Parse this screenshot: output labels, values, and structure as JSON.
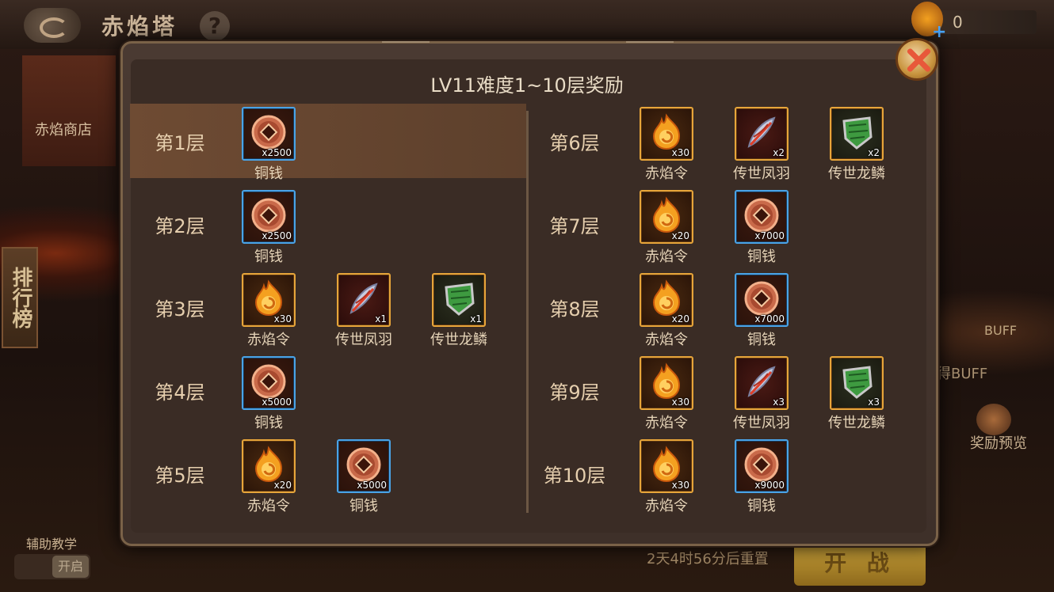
{
  "header": {
    "title": "赤焰塔",
    "help": "?",
    "currency_value": "0",
    "currency_plus": "+"
  },
  "sidebar": {
    "shop_label": "赤焰商店",
    "rank_label": "排行榜",
    "tutorial_label": "辅助教学",
    "tutorial_toggle": "开启"
  },
  "right_side": {
    "buff_label": "BUFF",
    "buff_text": "得BUFF",
    "preview_label": "奖励预览"
  },
  "footer": {
    "reset_text": "2天4时56分后重置",
    "fight_label": "开 战"
  },
  "modal": {
    "title": "LV11难度1~10层奖励",
    "left_rows": [
      {
        "floor": "第1层",
        "highlight": true,
        "items": [
          {
            "type": "coin",
            "name": "铜钱",
            "qty": "x2500"
          }
        ]
      },
      {
        "floor": "第2层",
        "items": [
          {
            "type": "coin",
            "name": "铜钱",
            "qty": "x2500"
          }
        ]
      },
      {
        "floor": "第3层",
        "items": [
          {
            "type": "flame",
            "name": "赤焰令",
            "qty": "x30"
          },
          {
            "type": "feather",
            "name": "传世凤羽",
            "qty": "x1"
          },
          {
            "type": "scale",
            "name": "传世龙鳞",
            "qty": "x1"
          }
        ]
      },
      {
        "floor": "第4层",
        "items": [
          {
            "type": "coin",
            "name": "铜钱",
            "qty": "x5000"
          }
        ]
      },
      {
        "floor": "第5层",
        "items": [
          {
            "type": "flame",
            "name": "赤焰令",
            "qty": "x20"
          },
          {
            "type": "coin",
            "name": "铜钱",
            "qty": "x5000"
          }
        ]
      }
    ],
    "right_rows": [
      {
        "floor": "第6层",
        "items": [
          {
            "type": "flame",
            "name": "赤焰令",
            "qty": "x30"
          },
          {
            "type": "feather",
            "name": "传世凤羽",
            "qty": "x2"
          },
          {
            "type": "scale",
            "name": "传世龙鳞",
            "qty": "x2"
          }
        ]
      },
      {
        "floor": "第7层",
        "items": [
          {
            "type": "flame",
            "name": "赤焰令",
            "qty": "x20"
          },
          {
            "type": "coin",
            "name": "铜钱",
            "qty": "x7000"
          }
        ]
      },
      {
        "floor": "第8层",
        "items": [
          {
            "type": "flame",
            "name": "赤焰令",
            "qty": "x20"
          },
          {
            "type": "coin",
            "name": "铜钱",
            "qty": "x7000"
          }
        ]
      },
      {
        "floor": "第9层",
        "items": [
          {
            "type": "flame",
            "name": "赤焰令",
            "qty": "x30"
          },
          {
            "type": "feather",
            "name": "传世凤羽",
            "qty": "x3"
          },
          {
            "type": "scale",
            "name": "传世龙鳞",
            "qty": "x3"
          }
        ]
      },
      {
        "floor": "第10层",
        "items": [
          {
            "type": "flame",
            "name": "赤焰令",
            "qty": "x30"
          },
          {
            "type": "coin",
            "name": "铜钱",
            "qty": "x9000"
          }
        ]
      }
    ]
  }
}
